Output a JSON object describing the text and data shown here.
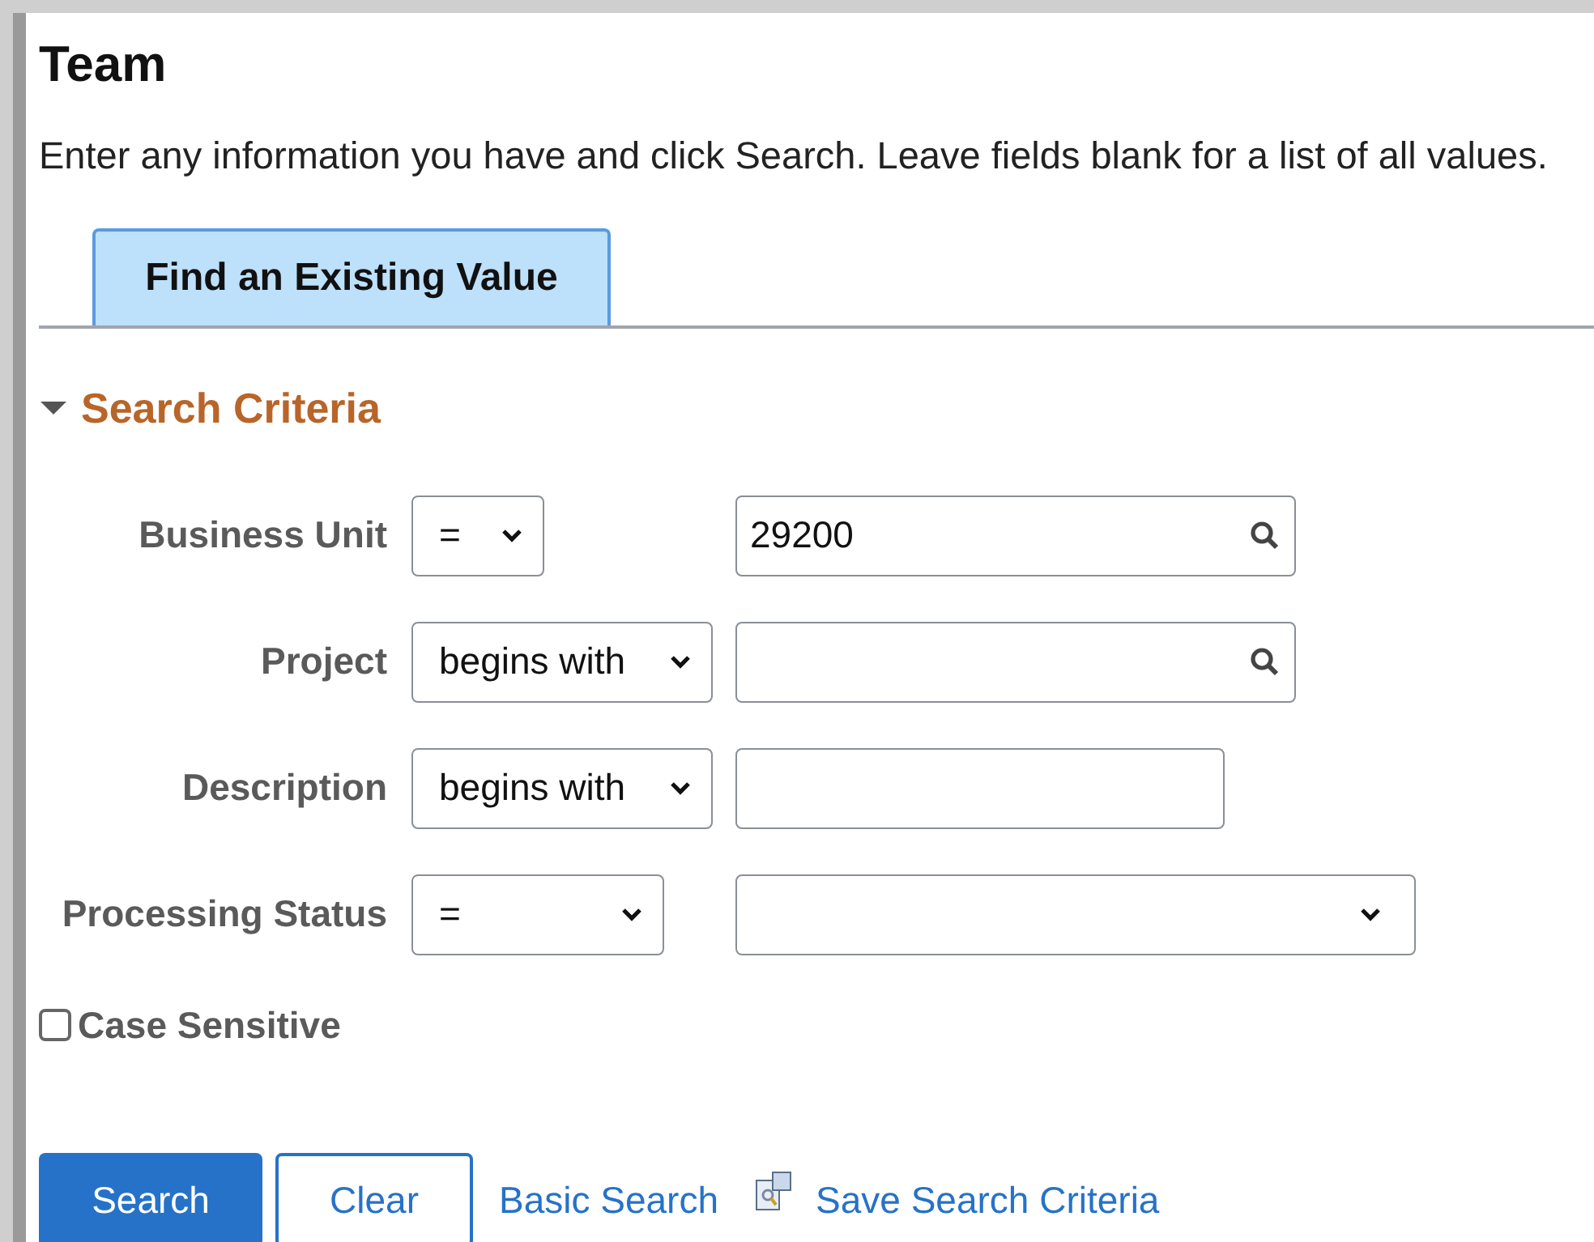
{
  "page": {
    "title": "Team",
    "instructions": "Enter any information you have and click Search. Leave fields blank for a list of all values."
  },
  "tabs": [
    {
      "label": "Find an Existing Value",
      "selected": true
    }
  ],
  "section": {
    "title": "Search Criteria",
    "expanded": true
  },
  "criteria": [
    {
      "label": "Business Unit",
      "operator": "=",
      "kind": "lookup",
      "value": "29200"
    },
    {
      "label": "Project",
      "operator": "begins with",
      "kind": "lookup"
    },
    {
      "label": "Description",
      "operator": "begins with",
      "kind": "text"
    },
    {
      "label": "Processing Status",
      "operator": "=",
      "kind": "dropdown"
    }
  ],
  "case_sensitive": {
    "label": "Case Sensitive",
    "checked": false
  },
  "actions": {
    "search": "Search",
    "clear": "Clear",
    "basic_search": "Basic Search",
    "save_criteria": "Save Search Criteria"
  }
}
